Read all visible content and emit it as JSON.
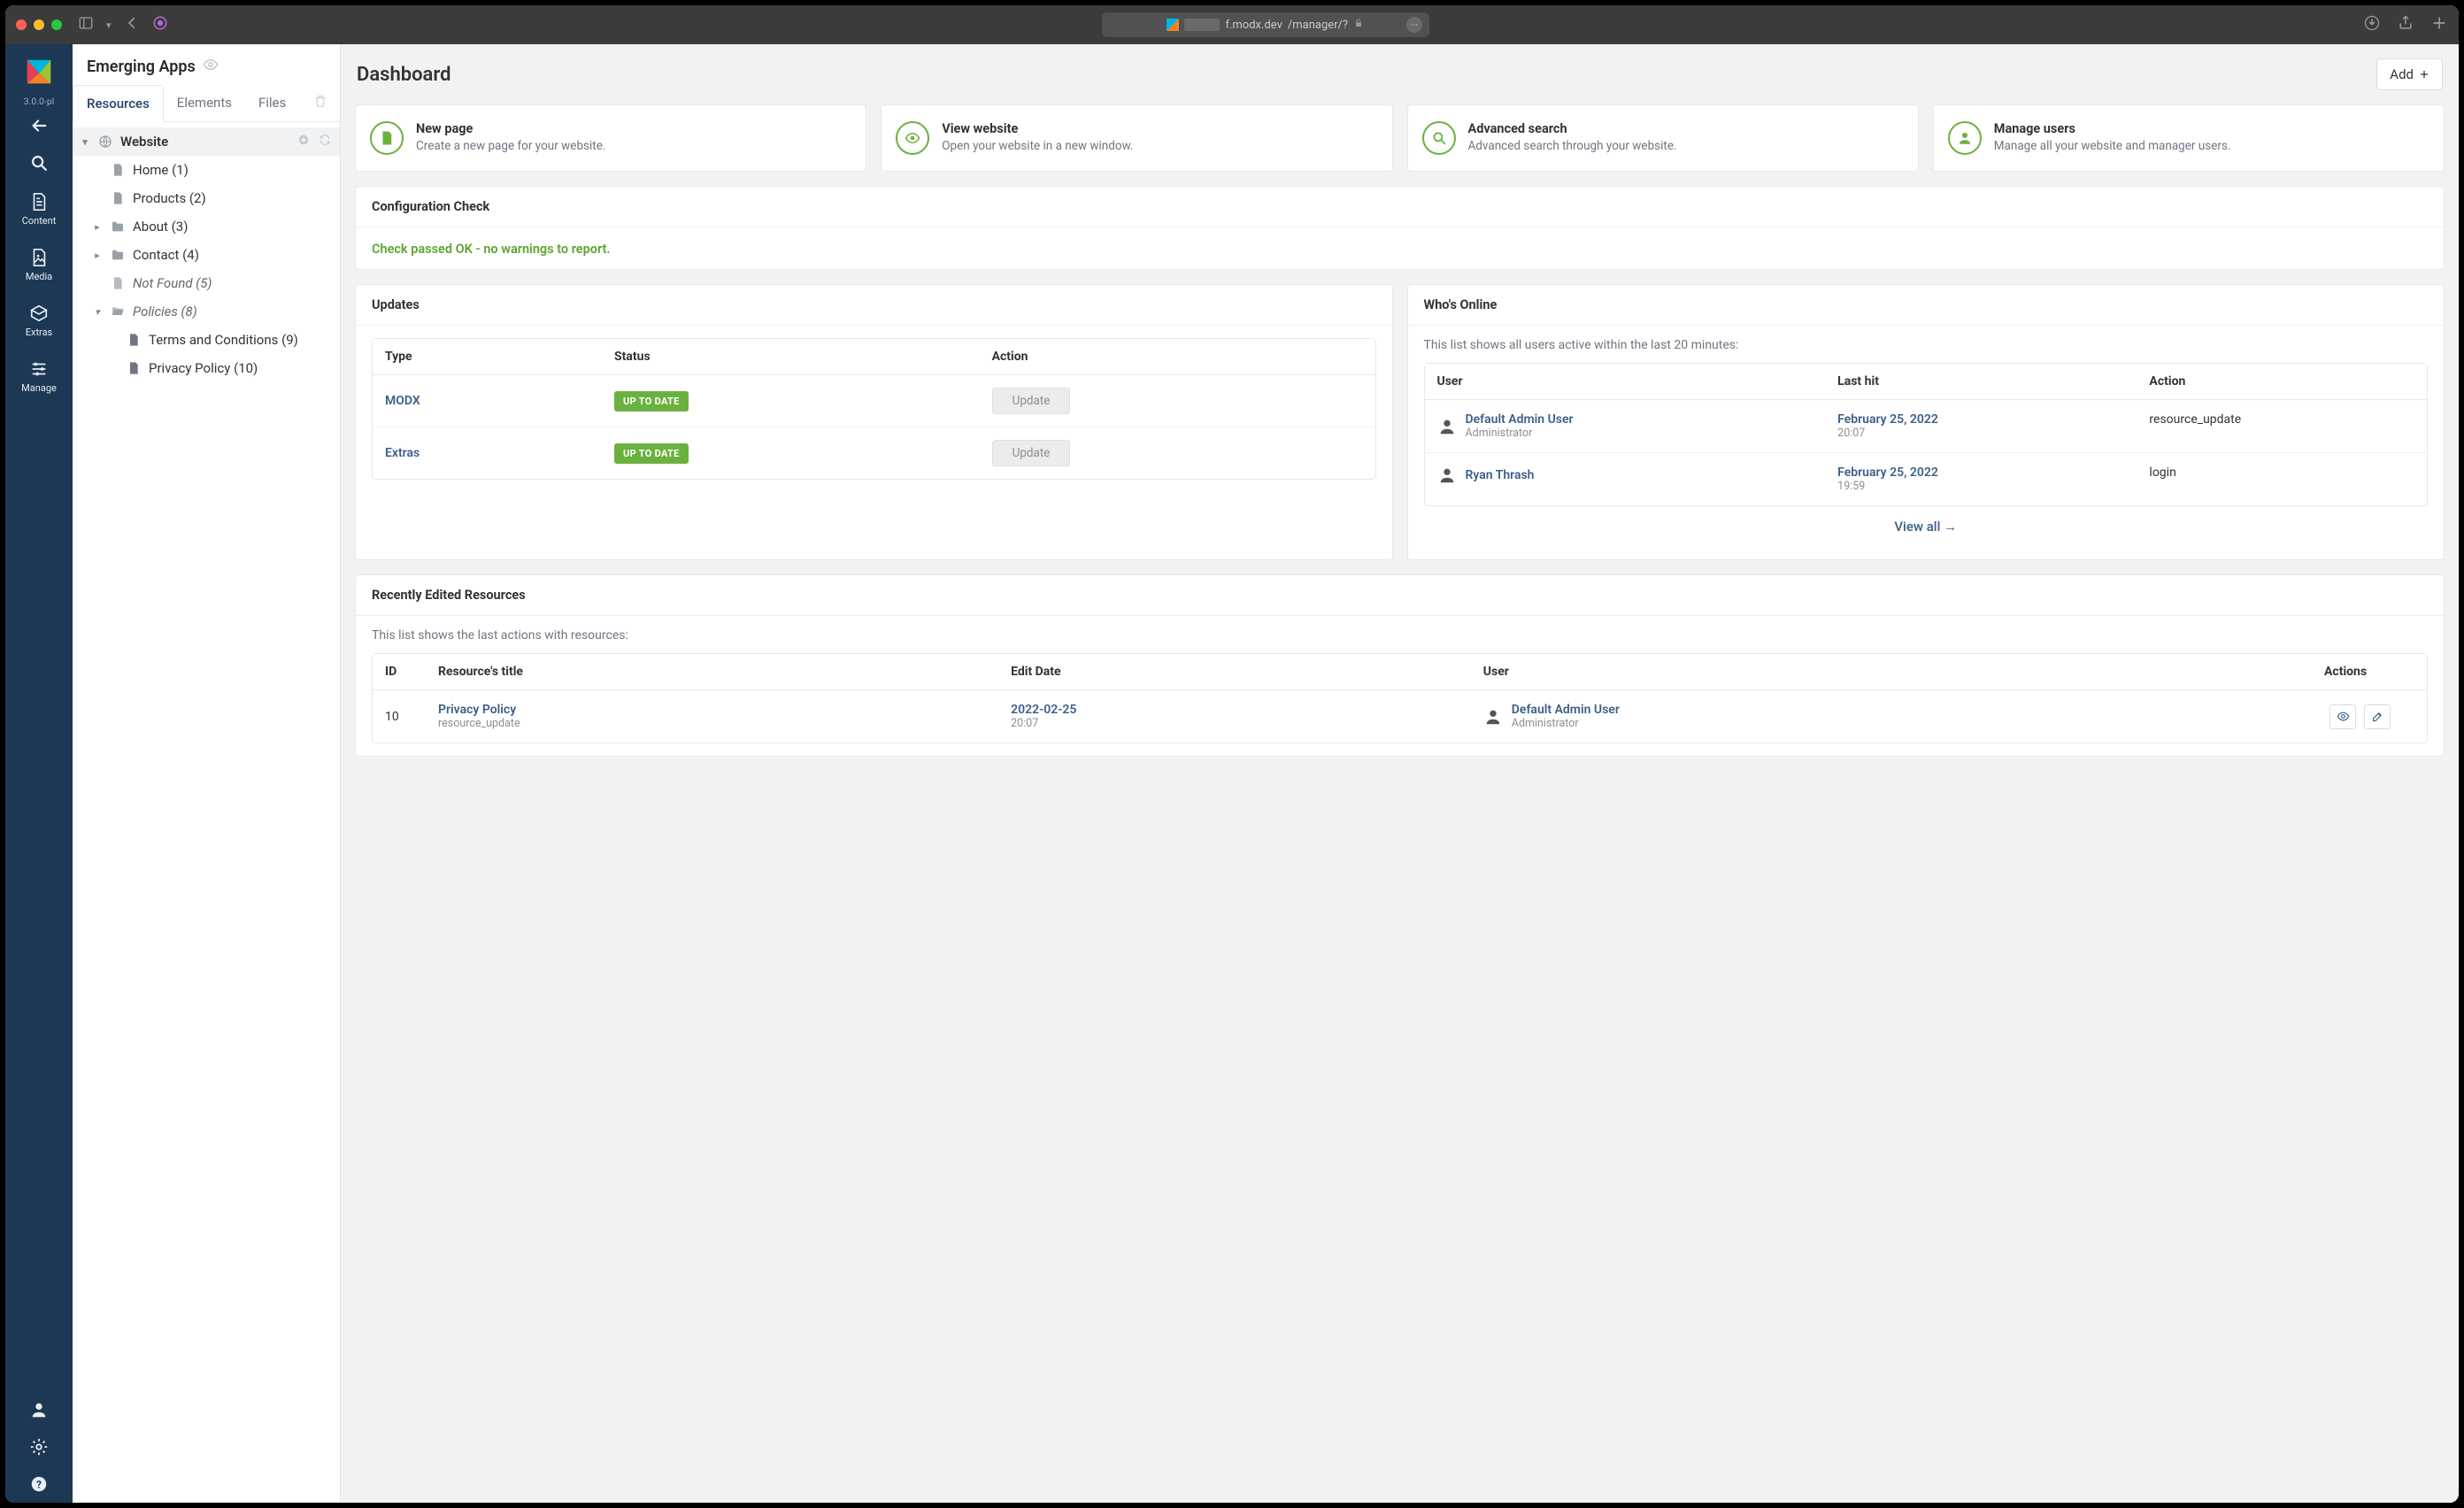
{
  "browser": {
    "url_host": "f.modx.dev",
    "url_path": "/manager/?"
  },
  "rail": {
    "version": "3.0.0-pl",
    "items": [
      "Content",
      "Media",
      "Extras",
      "Manage"
    ]
  },
  "treepanel": {
    "title": "Emerging Apps",
    "tabs": {
      "resources": "Resources",
      "elements": "Elements",
      "files": "Files"
    },
    "root": "Website",
    "nodes": {
      "home": "Home (1)",
      "products": "Products (2)",
      "about": "About (3)",
      "contact": "Contact (4)",
      "notfound": "Not Found (5)",
      "policies": "Policies (8)",
      "terms": "Terms and Conditions (9)",
      "privacy": "Privacy Policy (10)"
    }
  },
  "dashboard": {
    "title": "Dashboard",
    "add_label": "Add",
    "cards": {
      "new_page": {
        "title": "New page",
        "desc": "Create a new page for your website."
      },
      "view_site": {
        "title": "View website",
        "desc": "Open your website in a new window."
      },
      "adv_search": {
        "title": "Advanced search",
        "desc": "Advanced search through your website."
      },
      "manage_users": {
        "title": "Manage users",
        "desc": "Manage all your website and manager users."
      }
    },
    "config_check": {
      "title": "Configuration Check",
      "msg": "Check passed OK - no warnings to report."
    },
    "updates": {
      "title": "Updates",
      "cols": {
        "type": "Type",
        "status": "Status",
        "action": "Action"
      },
      "pill": "UP TO DATE",
      "actionbtn": "Update",
      "rows": [
        {
          "type": "MODX"
        },
        {
          "type": "Extras"
        }
      ]
    },
    "online": {
      "title": "Who's Online",
      "hint": "This list shows all users active within the last 20 minutes:",
      "cols": {
        "user": "User",
        "lasthit": "Last hit",
        "action": "Action"
      },
      "rows": [
        {
          "name": "Default Admin User",
          "role": "Administrator",
          "date": "February 25, 2022",
          "time": "20:07",
          "action": "resource_update"
        },
        {
          "name": "Ryan Thrash",
          "role": "",
          "date": "February 25, 2022",
          "time": "19:59",
          "action": "login"
        }
      ],
      "viewall": "View all →"
    },
    "recent": {
      "title": "Recently Edited Resources",
      "hint": "This list shows the last actions with resources:",
      "cols": {
        "id": "ID",
        "title": "Resource's title",
        "date": "Edit Date",
        "user": "User",
        "actions": "Actions"
      },
      "rows": [
        {
          "id": "10",
          "title": "Privacy Policy",
          "sub": "resource_update",
          "date": "2022-02-25",
          "time": "20:07",
          "user": "Default Admin User",
          "role": "Administrator"
        }
      ]
    }
  }
}
